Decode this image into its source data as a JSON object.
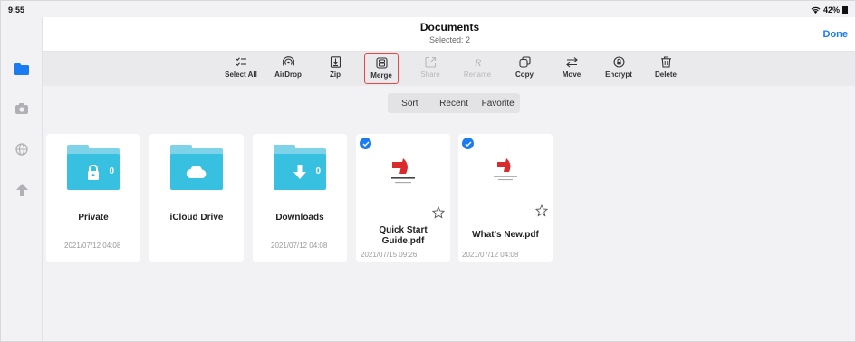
{
  "status_bar": {
    "time": "9:55",
    "battery": "42%"
  },
  "header": {
    "title": "Documents",
    "subtitle": "Selected: 2",
    "done_label": "Done"
  },
  "toolbar": {
    "items": [
      {
        "label": "Select All",
        "icon": "select-all-icon",
        "enabled": true
      },
      {
        "label": "AirDrop",
        "icon": "airdrop-icon",
        "enabled": true
      },
      {
        "label": "Zip",
        "icon": "zip-icon",
        "enabled": true
      },
      {
        "label": "Merge",
        "icon": "merge-icon",
        "enabled": true,
        "highlighted": true
      },
      {
        "label": "Share",
        "icon": "share-icon",
        "enabled": false
      },
      {
        "label": "Rename",
        "icon": "rename-icon",
        "enabled": false
      },
      {
        "label": "Copy",
        "icon": "copy-icon",
        "enabled": true
      },
      {
        "label": "Move",
        "icon": "move-icon",
        "enabled": true
      },
      {
        "label": "Encrypt",
        "icon": "encrypt-icon",
        "enabled": true
      },
      {
        "label": "Delete",
        "icon": "trash-icon",
        "enabled": true
      }
    ]
  },
  "sort_segment": {
    "options": [
      "Sort",
      "Recent",
      "Favorite"
    ]
  },
  "sidebar": {
    "items": [
      "folder-icon",
      "camera-icon",
      "globe-icon",
      "upload-icon"
    ]
  },
  "files": [
    {
      "name": "Private",
      "date": "2021/07/12 04:08",
      "type": "folder",
      "count": "0",
      "selected": false
    },
    {
      "name": "iCloud Drive",
      "date": "",
      "type": "folder",
      "count": "",
      "selected": false
    },
    {
      "name": "Downloads",
      "date": "2021/07/12 04:08",
      "type": "folder",
      "count": "0",
      "selected": false
    },
    {
      "name": "Quick Start Guide.pdf",
      "date": "2021/07/15 09:26",
      "type": "pdf",
      "selected": true
    },
    {
      "name": "What's New.pdf",
      "date": "2021/07/12 04:08",
      "type": "pdf",
      "selected": true
    }
  ],
  "colors": {
    "accent": "#1a7cf0",
    "folder": "#37c0e0",
    "highlight": "#e04848",
    "pdf_red": "#d92b2b"
  }
}
